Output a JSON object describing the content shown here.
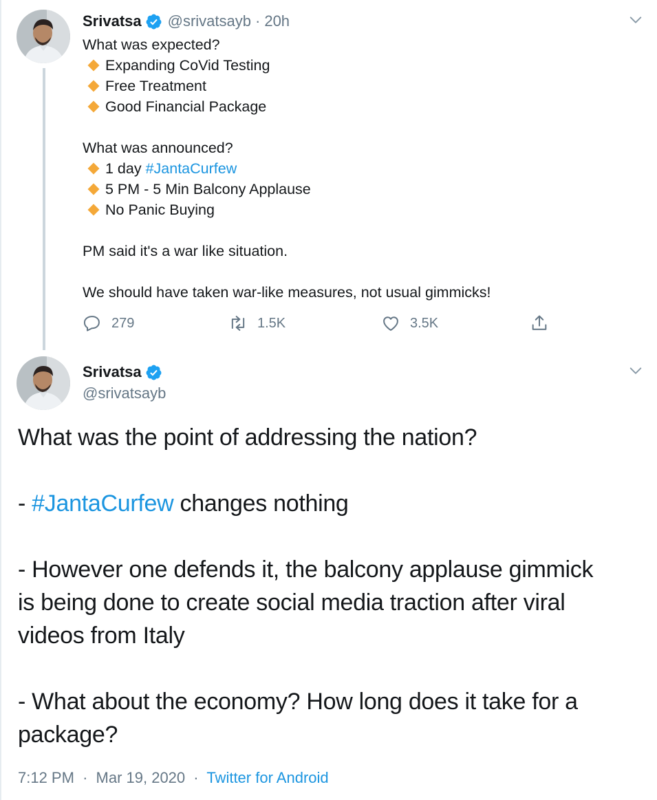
{
  "tweet1": {
    "author_name": "Srivatsa",
    "author_handle": "@srivatsayb",
    "separator": "·",
    "time_ago": "20h",
    "lines": [
      {
        "kind": "text",
        "text": "What was expected?"
      },
      {
        "kind": "bullet",
        "text": "Expanding CoVid Testing"
      },
      {
        "kind": "bullet",
        "text": "Free Treatment"
      },
      {
        "kind": "bullet",
        "text": "Good Financial Package"
      },
      {
        "kind": "blank"
      },
      {
        "kind": "text",
        "text": "What was announced?"
      },
      {
        "kind": "bullet",
        "text": "1 day ",
        "hashtag": "#JantaCurfew"
      },
      {
        "kind": "bullet",
        "text": "5 PM - 5 Min Balcony Applause"
      },
      {
        "kind": "bullet",
        "text": "No Panic Buying"
      },
      {
        "kind": "blank"
      },
      {
        "kind": "text",
        "text": "PM said it's a war like situation."
      },
      {
        "kind": "blank"
      },
      {
        "kind": "text",
        "text": "We should have taken war-like measures, not usual gimmicks!"
      }
    ],
    "bullet_color": "#f4a838",
    "replies": "279",
    "retweets": "1.5K",
    "likes": "3.5K"
  },
  "tweet2": {
    "author_name": "Srivatsa",
    "author_handle": "@srivatsayb",
    "lines": [
      {
        "kind": "text",
        "text": "What was the point of addressing the nation?"
      },
      {
        "kind": "blank"
      },
      {
        "kind": "text",
        "prefix": "- ",
        "hashtag": "#JantaCurfew",
        "text": " changes nothing"
      },
      {
        "kind": "blank"
      },
      {
        "kind": "text",
        "text": "- However one defends it, the balcony applause gimmick"
      },
      {
        "kind": "text",
        "text": "is being done to create social media traction after viral"
      },
      {
        "kind": "text",
        "text": "videos from Italy"
      },
      {
        "kind": "blank"
      },
      {
        "kind": "text",
        "text": "- What about the economy? How long does it take for a"
      },
      {
        "kind": "text",
        "text": "package?"
      }
    ],
    "time": "7:12 PM",
    "separator": "·",
    "date": "Mar 19, 2020",
    "source": "Twitter for Android"
  },
  "icons": {
    "verified": "verified-badge-icon",
    "caret": "chevron-down-icon",
    "reply": "reply-icon",
    "retweet": "retweet-icon",
    "like": "heart-icon",
    "share": "share-icon"
  },
  "colors": {
    "link": "#1b95e0",
    "verified": "#1da1f2",
    "secondary_text": "#657786",
    "thread_line": "#ccd6dd"
  }
}
